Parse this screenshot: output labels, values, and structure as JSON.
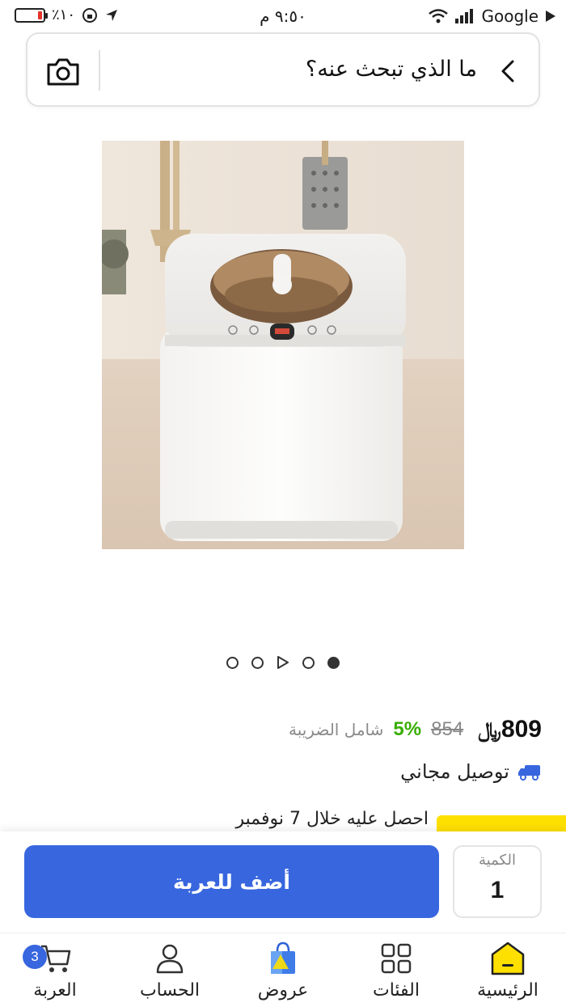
{
  "status_bar": {
    "battery": "٪١٠",
    "time": "٩:٥٠ م",
    "carrier": "Google"
  },
  "search": {
    "placeholder": "ما الذي تبحث عنه؟",
    "icons": [
      "camera-icon",
      "chevron-left-icon"
    ]
  },
  "product": {
    "image_alt": "",
    "carousel": {
      "count": 5,
      "active_index": 4,
      "video_index": 2
    }
  },
  "pricing": {
    "current_price": "809",
    "currency_symbol": "﷼",
    "old_price": "854",
    "discount": "5%",
    "tax_note": "شامل الضريبة"
  },
  "delivery": {
    "label": "توصيل مجاني",
    "icon": "truck-icon"
  },
  "express": {
    "text": "احصل عليه خلال 7 نوفمبر",
    "badge_color": "#fee000"
  },
  "actions": {
    "add_to_cart": "أضف للعربة",
    "quantity_label": "الكمية",
    "quantity_value": "1"
  },
  "bottom_nav": {
    "home": "الرئيسية",
    "categories": "الفئات",
    "offers": "عروض",
    "account": "الحساب",
    "cart": "العربة",
    "cart_count": "3"
  },
  "colors": {
    "primary": "#3866df",
    "accent_yellow": "#fee000",
    "discount_green": "#38ae04"
  }
}
